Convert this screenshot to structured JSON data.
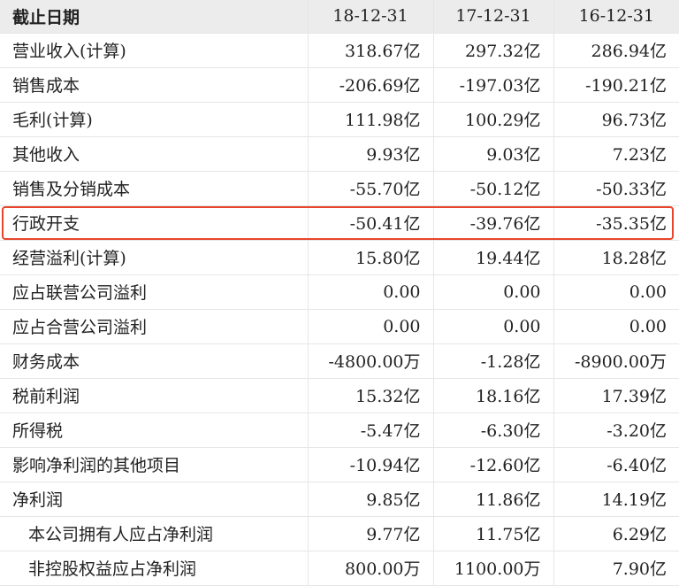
{
  "header": {
    "label": "截止日期",
    "periods": [
      "18-12-31",
      "17-12-31",
      "16-12-31"
    ]
  },
  "rows": [
    {
      "label": "营业收入(计算)",
      "values": [
        "318.67亿",
        "297.32亿",
        "286.94亿"
      ],
      "indent": false
    },
    {
      "label": "销售成本",
      "values": [
        "-206.69亿",
        "-197.03亿",
        "-190.21亿"
      ],
      "indent": false
    },
    {
      "label": "毛利(计算)",
      "values": [
        "111.98亿",
        "100.29亿",
        "96.73亿"
      ],
      "indent": false
    },
    {
      "label": "其他收入",
      "values": [
        "9.93亿",
        "9.03亿",
        "7.23亿"
      ],
      "indent": false
    },
    {
      "label": "销售及分销成本",
      "values": [
        "-55.70亿",
        "-50.12亿",
        "-50.33亿"
      ],
      "indent": false
    },
    {
      "label": "行政开支",
      "values": [
        "-50.41亿",
        "-39.76亿",
        "-35.35亿"
      ],
      "indent": false
    },
    {
      "label": "经营溢利(计算)",
      "values": [
        "15.80亿",
        "19.44亿",
        "18.28亿"
      ],
      "indent": false
    },
    {
      "label": "应占联营公司溢利",
      "values": [
        "0.00",
        "0.00",
        "0.00"
      ],
      "indent": false
    },
    {
      "label": "应占合营公司溢利",
      "values": [
        "0.00",
        "0.00",
        "0.00"
      ],
      "indent": false
    },
    {
      "label": "财务成本",
      "values": [
        "-4800.00万",
        "-1.28亿",
        "-8900.00万"
      ],
      "indent": false
    },
    {
      "label": "税前利润",
      "values": [
        "15.32亿",
        "18.16亿",
        "17.39亿"
      ],
      "indent": false
    },
    {
      "label": "所得税",
      "values": [
        "-5.47亿",
        "-6.30亿",
        "-3.20亿"
      ],
      "indent": false
    },
    {
      "label": "影响净利润的其他项目",
      "values": [
        "-10.94亿",
        "-12.60亿",
        "-6.40亿"
      ],
      "indent": false
    },
    {
      "label": "净利润",
      "values": [
        "9.85亿",
        "11.86亿",
        "14.19亿"
      ],
      "indent": false
    },
    {
      "label": "本公司拥有人应占净利润",
      "values": [
        "9.77亿",
        "11.75亿",
        "6.29亿"
      ],
      "indent": true
    },
    {
      "label": "非控股权益应占净利润",
      "values": [
        "800.00万",
        "1100.00万",
        "7.90亿"
      ],
      "indent": true
    }
  ],
  "highlight_row_index": 5,
  "colors": {
    "highlight_border": "#e8452e",
    "header_bg": "#ececec"
  }
}
